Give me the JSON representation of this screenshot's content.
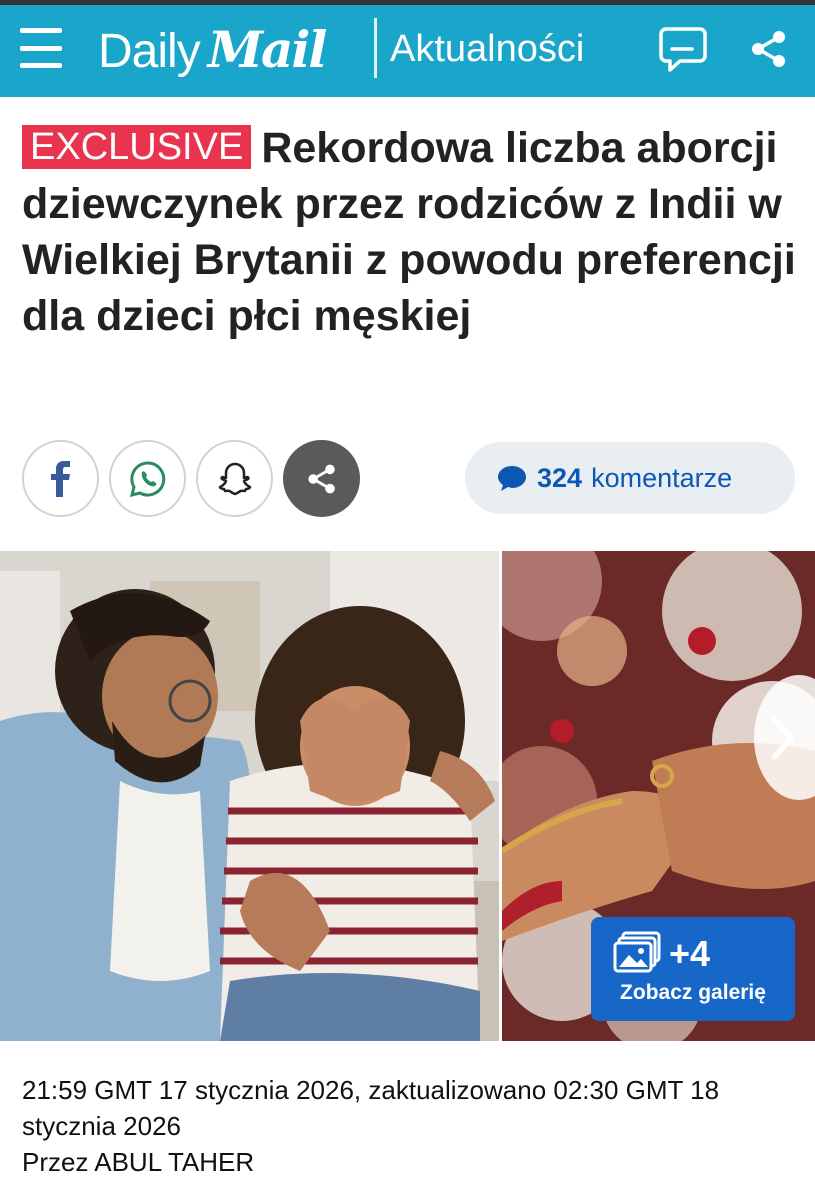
{
  "header": {
    "brand_daily": "Daily",
    "brand_mail": "Mail",
    "section": "Aktualności",
    "colors": {
      "bar": "#1aa6cb"
    },
    "icons": [
      "menu-icon",
      "comment-bubble-icon",
      "share-icon"
    ]
  },
  "article": {
    "badge": "EXCLUSIVE",
    "headline": "Rekordowa liczba aborcji dziewczynek przez rodziców z Indii w Wielkiej Brytanii z powodu preferencji dla dzieci płci męskiej",
    "badge_color": "#e8344e"
  },
  "share": {
    "buttons": [
      "facebook-icon",
      "whatsapp-icon",
      "snapchat-icon",
      "share-icon"
    ],
    "comments_count": "324",
    "comments_label": "komentarze",
    "comments_color": "#0d58b5"
  },
  "gallery": {
    "count": "+4",
    "label": "Zobacz galerię",
    "color": "#1767c9"
  },
  "meta": {
    "published": "21:59 GMT 17 stycznia 2026, zaktualizowano 02:30 GMT 18 stycznia 2026",
    "byline": "Przez ABUL TAHER"
  }
}
